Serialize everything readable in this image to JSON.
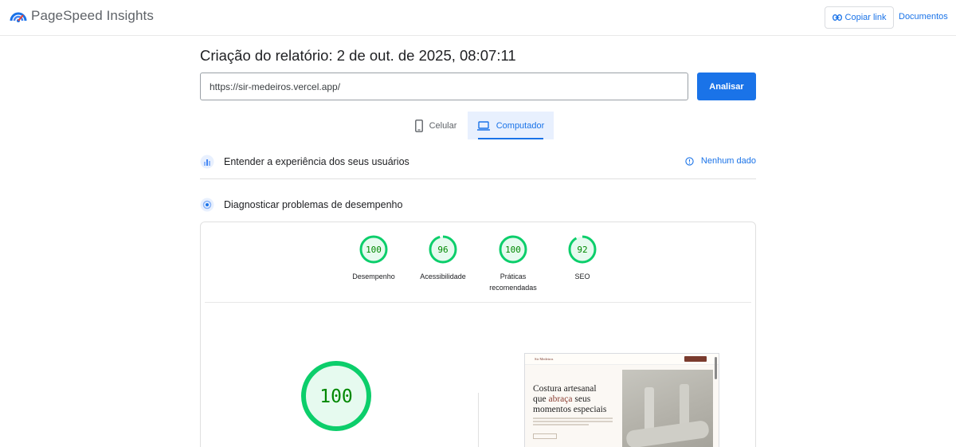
{
  "header": {
    "app_name": "PageSpeed Insights",
    "copy_link_label": "Copiar link",
    "docs_label": "Documentos",
    "logo_icon": "pagespeed-logo-icon",
    "accent_color": "#1a73e8"
  },
  "report": {
    "title": "Criação do relatório: 2 de out. de 2025, 08:07:11",
    "url_value": "https://sir-medeiros.vercel.app/",
    "analyze_label": "Analisar"
  },
  "device_tabs": [
    {
      "label": "Celular",
      "icon": "mobile-phone-icon",
      "selected": false
    },
    {
      "label": "Computador",
      "icon": "laptop-icon",
      "selected": true
    }
  ],
  "sections": {
    "user_experience": {
      "label": "Entender a experiência dos seus usuários",
      "icon": "users-chart-icon",
      "status_label": "Nenhum dado",
      "status_icon": "info-icon"
    },
    "diagnostics": {
      "label": "Diagnosticar problemas de desempenho",
      "icon": "diagnostics-icon"
    }
  },
  "scores": [
    {
      "label": "Desempenho",
      "value": 100,
      "color": "#0cce6b"
    },
    {
      "label": "Acessibilidade",
      "value": 96,
      "color": "#0cce6b"
    },
    {
      "label": "Práticas recomendadas",
      "value": 100,
      "color": "#0cce6b"
    },
    {
      "label": "SEO",
      "value": 92,
      "color": "#0cce6b"
    }
  ],
  "main_score": {
    "value": 100,
    "color": "#0cce6b"
  },
  "screenshot": {
    "brand": "Sir Medeiros",
    "heading_line1": "Costura artesanal",
    "heading_que": "que ",
    "heading_accent": "abraça",
    "heading_rest": " seus momentos especiais"
  }
}
